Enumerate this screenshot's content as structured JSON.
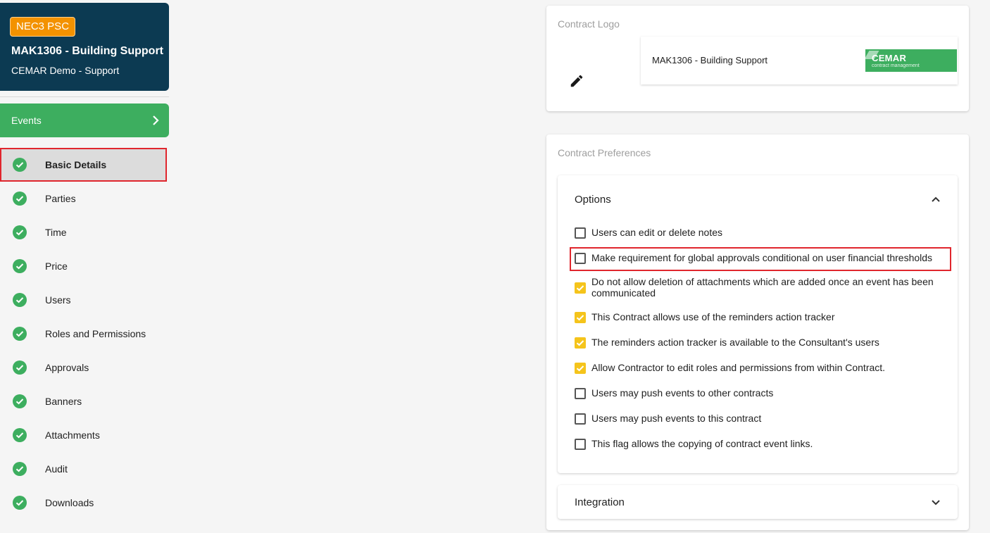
{
  "contract": {
    "badge": "NEC3 PSC",
    "title": "MAK1306 - Building Support",
    "subtitle": "CEMAR Demo - Support"
  },
  "events": {
    "label": "Events",
    "icon": "chevron-right-icon"
  },
  "nav": {
    "items": [
      {
        "label": "Basic Details",
        "active": true
      },
      {
        "label": "Parties"
      },
      {
        "label": "Time"
      },
      {
        "label": "Price"
      },
      {
        "label": "Users"
      },
      {
        "label": "Roles and Permissions"
      },
      {
        "label": "Approvals"
      },
      {
        "label": "Banners"
      },
      {
        "label": "Attachments"
      },
      {
        "label": "Audit"
      },
      {
        "label": "Downloads"
      }
    ]
  },
  "logo_panel": {
    "title": "Contract Logo",
    "card_text": "MAK1306 - Building Support",
    "logo_name": "CEMAR",
    "logo_tagline": "contract management"
  },
  "prefs_panel": {
    "title": "Contract Preferences",
    "options": {
      "header": "Options",
      "items": [
        {
          "label": "Users can edit or delete notes",
          "checked": false
        },
        {
          "label": "Make requirement for global approvals conditional on user financial thresholds",
          "checked": false
        },
        {
          "label": "Do not allow deletion of attachments which are added once an event has been communicated",
          "checked": true
        },
        {
          "label": "This Contract allows use of the reminders action tracker",
          "checked": true
        },
        {
          "label": "The reminders action tracker is available to the Consultant's users",
          "checked": true
        },
        {
          "label": "Allow Contractor to edit roles and permissions from within Contract.",
          "checked": true
        },
        {
          "label": "Users may push events to other contracts",
          "checked": false
        },
        {
          "label": "Users may push events to this contract",
          "checked": false
        },
        {
          "label": "This flag allows the copying of contract event links.",
          "checked": false
        }
      ]
    },
    "integration": {
      "header": "Integration"
    }
  },
  "colors": {
    "sidebar_card": "#0c3a52",
    "badge": "#f39200",
    "green": "#3dae5f",
    "checkbox_on": "#f5c41b",
    "highlight": "#e0262d"
  }
}
